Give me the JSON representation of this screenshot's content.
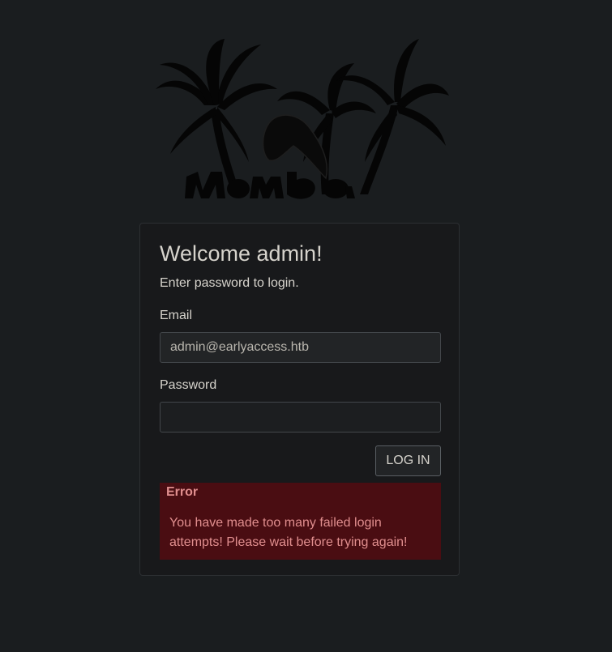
{
  "logo": {
    "text": "Mamba",
    "icon": "palm-trees-snake-logo"
  },
  "login": {
    "title": "Welcome admin!",
    "subtitle": "Enter password to login.",
    "email_label": "Email",
    "email_value": "admin@earlyaccess.htb",
    "password_label": "Password",
    "password_value": "",
    "submit_label": "LOG IN"
  },
  "error": {
    "title": "Error",
    "message": "You have made too many failed login attempts! Please wait before trying again!"
  },
  "colors": {
    "background": "#1a1d1f",
    "card": "#18191b",
    "text": "#d6d3cc",
    "error_bg": "#4a0d12",
    "error_text": "#e08e8e"
  }
}
